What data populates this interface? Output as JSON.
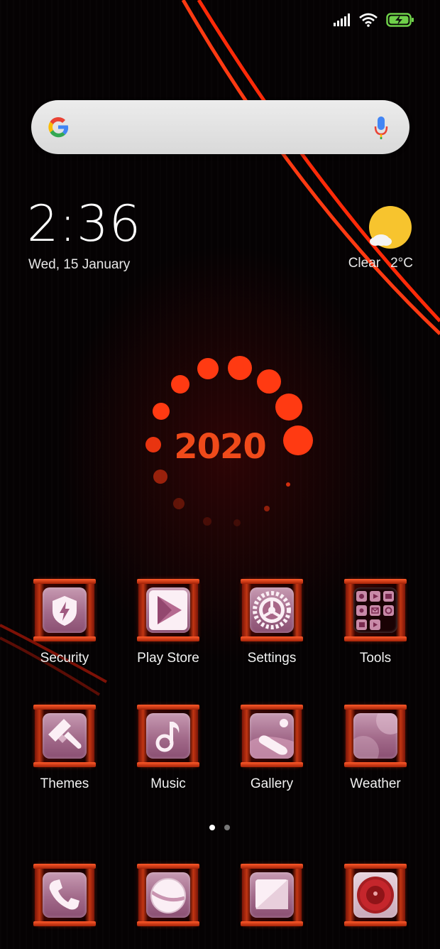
{
  "status_bar": {
    "icons": [
      "signal-icon",
      "wifi-icon",
      "battery-charging-icon"
    ],
    "battery_color": "#6fd04a"
  },
  "search_bar": {
    "icons": [
      "google-logo-icon",
      "microphone-icon"
    ]
  },
  "clock_widget": {
    "time": "2:36",
    "date": "Wed, 15 January"
  },
  "weather_widget": {
    "icon": "sun-cloud-icon",
    "condition": "Clear",
    "temperature": "2°C"
  },
  "wallpaper": {
    "year_text": "2020",
    "accent_color": "#ff3a12"
  },
  "home_apps": [
    {
      "label": "Security",
      "icon": "shield-icon"
    },
    {
      "label": "Play Store",
      "icon": "play-store-icon"
    },
    {
      "label": "Settings",
      "icon": "gear-icon"
    },
    {
      "label": "Tools",
      "icon": "tools-folder-icon"
    },
    {
      "label": "Themes",
      "icon": "paintbrush-icon"
    },
    {
      "label": "Music",
      "icon": "music-note-icon"
    },
    {
      "label": "Gallery",
      "icon": "gallery-icon"
    },
    {
      "label": "Weather",
      "icon": "weather-app-icon"
    }
  ],
  "page_indicator": {
    "pages": 2,
    "current": 1
  },
  "dock_apps": [
    {
      "icon": "phone-icon"
    },
    {
      "icon": "browser-icon"
    },
    {
      "icon": "messages-icon"
    },
    {
      "icon": "camera-icon"
    }
  ]
}
